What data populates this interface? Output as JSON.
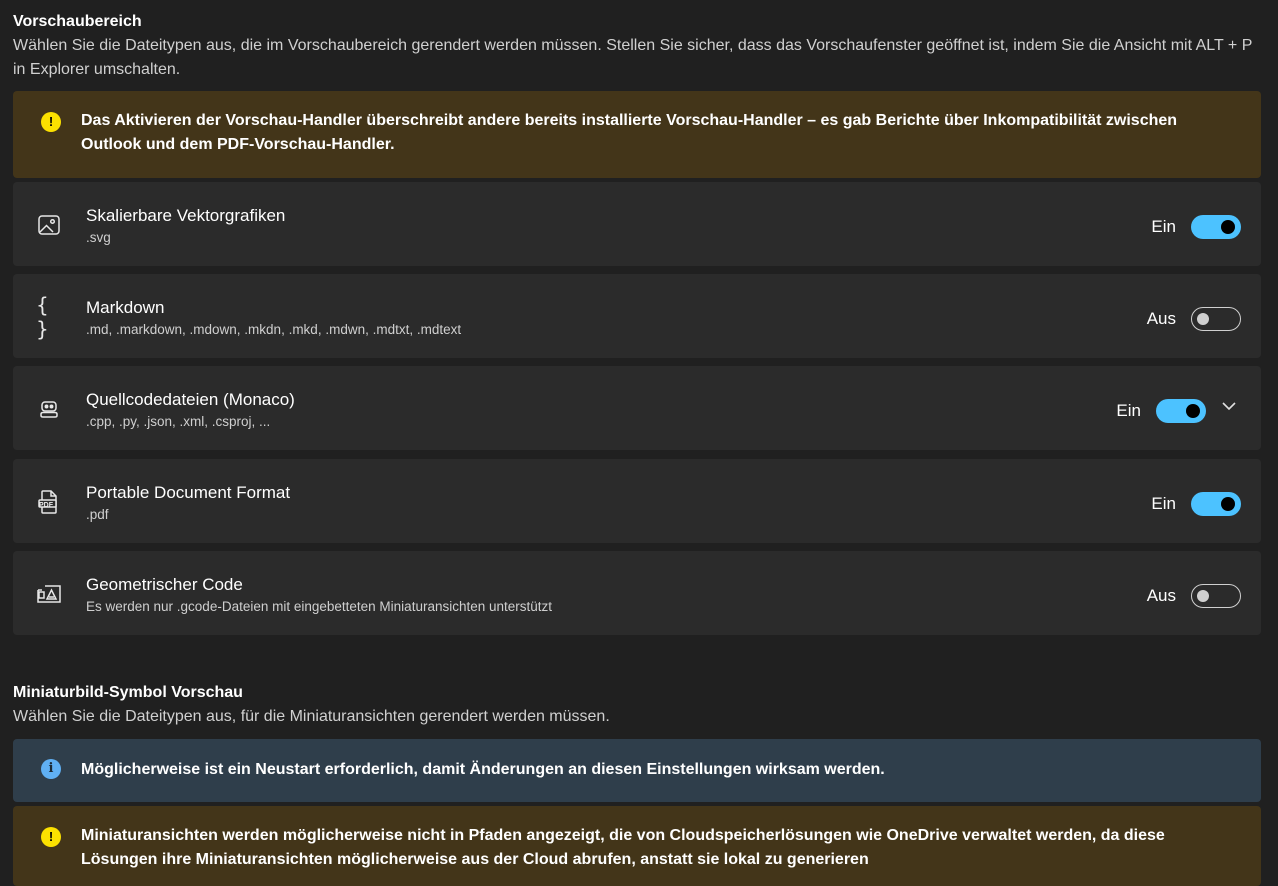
{
  "preview": {
    "title": "Vorschaubereich",
    "description": "Wählen Sie die Dateitypen aus, die im Vorschaubereich gerendert werden müssen. Stellen Sie sicher, dass das Vorschaufenster geöffnet ist, indem Sie die Ansicht mit ALT + P in Explorer umschalten.",
    "warning": "Das Aktivieren der Vorschau-Handler überschreibt andere bereits installierte Vorschau-Handler – es gab Berichte über Inkompatibilität zwischen Outlook und dem PDF-Vorschau-Handler.",
    "warning_icon_text": "!",
    "items": [
      {
        "icon": "image-icon",
        "title": "Skalierbare Vektorgrafiken",
        "sub": ".svg",
        "state": "Ein",
        "on": true
      },
      {
        "icon": "braces-icon",
        "title": "Markdown",
        "sub": ".md, .markdown, .mdown, .mkdn, .mkd, .mdwn, .mdtxt, .mdtext",
        "state": "Aus",
        "on": false,
        "icon_text": "{ }"
      },
      {
        "icon": "robot-icon",
        "title": "Quellcodedateien (Monaco)",
        "sub": ".cpp, .py, .json, .xml, .csproj, ...",
        "state": "Ein",
        "on": true,
        "expandable": true
      },
      {
        "icon": "pdf-icon",
        "title": "Portable Document Format",
        "sub": ".pdf",
        "state": "Ein",
        "on": true,
        "icon_text": "PDF"
      },
      {
        "icon": "geometry-icon",
        "title": "Geometrischer Code",
        "sub": "Es werden nur .gcode-Dateien mit eingebetteten Miniaturansichten unterstützt",
        "state": "Aus",
        "on": false
      }
    ]
  },
  "thumbnail": {
    "title": "Miniaturbild-Symbol Vorschau",
    "description": "Wählen Sie die Dateitypen aus, für die Miniaturansichten gerendert werden müssen.",
    "info": "Möglicherweise ist ein Neustart erforderlich, damit Änderungen an diesen Einstellungen wirksam werden.",
    "info_icon_text": "i",
    "warning": "Miniaturansichten werden möglicherweise nicht in Pfaden angezeigt, die von Cloudspeicherlösungen wie OneDrive verwaltet werden, da diese Lösungen ihre Miniaturansichten möglicherweise aus der Cloud abrufen, anstatt sie lokal zu generieren",
    "warning_icon_text": "!"
  },
  "colors": {
    "accent": "#4cc2ff",
    "warning_bg": "#433519",
    "info_bg": "#2f3e4b",
    "card_bg": "#2b2b2b"
  }
}
